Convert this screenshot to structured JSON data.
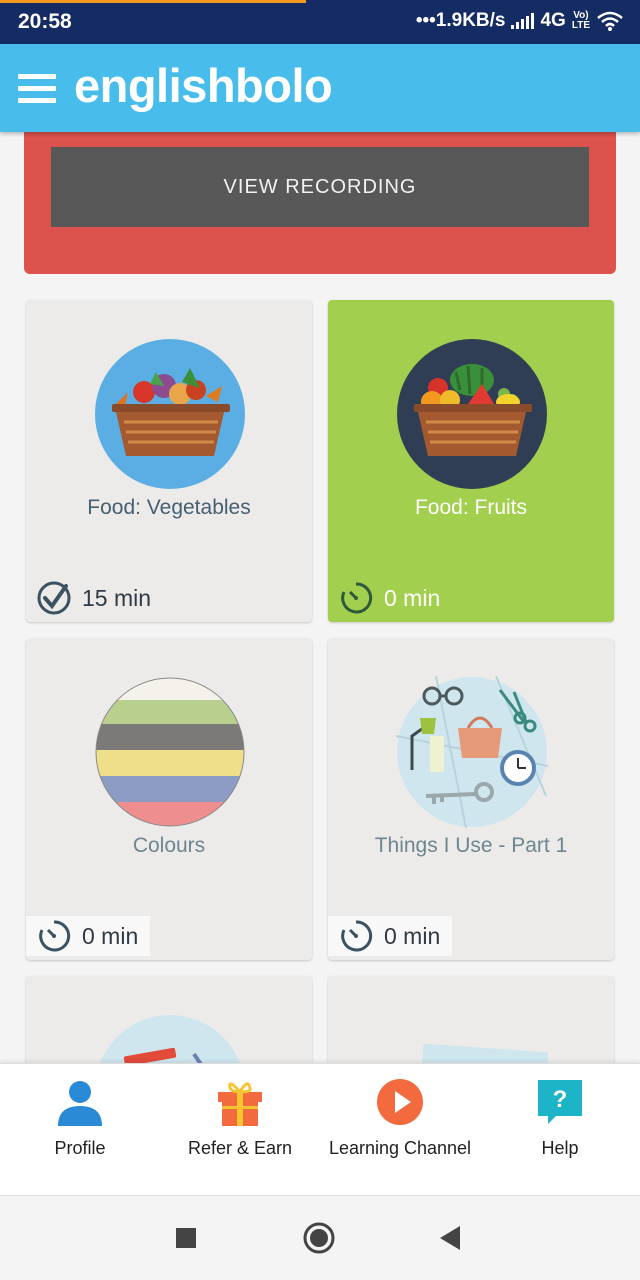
{
  "status": {
    "time": "20:58",
    "speed": "•••1.9KB/s",
    "network": "4G",
    "volte_top": "Vo)",
    "volte_bottom": "LTE"
  },
  "app": {
    "logo": "englishbolo",
    "menu_icon": "hamburger-menu-icon"
  },
  "banner": {
    "button_label": "VIEW RECORDING",
    "color": "#dc524d"
  },
  "topics": [
    {
      "title": "Food: Vegetables",
      "time": "15 min",
      "status": "completed",
      "icon": "vegetable-basket-icon"
    },
    {
      "title": "Food: Fruits",
      "time": "0 min",
      "status": "active",
      "icon": "fruit-basket-icon"
    },
    {
      "title": "Colours",
      "time": "0 min",
      "status": "not-started",
      "icon": "colour-stripes-icon"
    },
    {
      "title": "Things I Use - Part 1",
      "time": "0 min",
      "status": "not-started",
      "icon": "household-objects-icon"
    }
  ],
  "bottom_nav": [
    {
      "label": "Profile",
      "icon": "profile-icon"
    },
    {
      "label": "Refer & Earn",
      "icon": "gift-icon"
    },
    {
      "label": "Learning Channel",
      "icon": "play-icon"
    },
    {
      "label": "Help",
      "icon": "help-icon"
    }
  ],
  "colors": {
    "app_bar": "#48bdec",
    "status_bar": "#142c63",
    "active_card": "#a2cf4d",
    "card": "#ecebea"
  }
}
